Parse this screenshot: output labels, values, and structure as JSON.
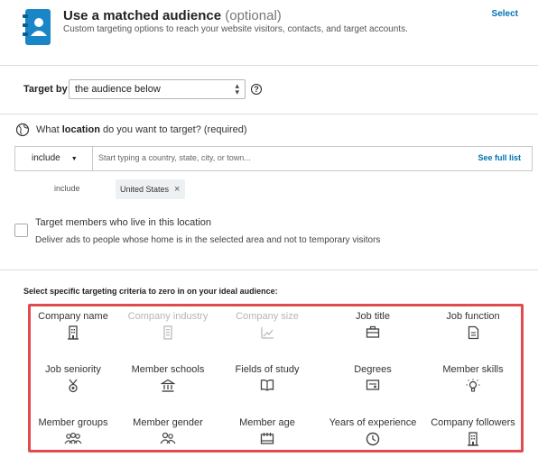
{
  "header": {
    "title_bold": "Use a matched audience",
    "title_optional": "(optional)",
    "subtitle": "Custom targeting options to reach your website visitors, contacts, and target accounts.",
    "select_link": "Select"
  },
  "target_by": {
    "label": "Target by",
    "selected": "the audience below",
    "help": "?"
  },
  "location": {
    "question_pre": "What",
    "question_bold": "location",
    "question_post": "do you want to target? (required)",
    "include_select": "include",
    "input_placeholder": "Start typing a country, state, city, or town...",
    "see_full_list": "See full list",
    "include_label": "include",
    "selected_locations": [
      "United States"
    ]
  },
  "live_in": {
    "title": "Target members who live in this location",
    "description": "Deliver ads to people whose home is in the selected area and not to temporary visitors",
    "checked": false
  },
  "criteria": {
    "label": "Select specific targeting criteria to zero in on your ideal audience:",
    "items": [
      {
        "label": "Company name",
        "icon": "building-icon",
        "enabled": true
      },
      {
        "label": "Company industry",
        "icon": "industry-icon",
        "enabled": false
      },
      {
        "label": "Company size",
        "icon": "growth-chart-icon",
        "enabled": false
      },
      {
        "label": "Job title",
        "icon": "briefcase-icon",
        "enabled": true
      },
      {
        "label": "Job function",
        "icon": "document-icon",
        "enabled": true
      },
      {
        "label": "Job seniority",
        "icon": "medal-icon",
        "enabled": true
      },
      {
        "label": "Member schools",
        "icon": "institution-icon",
        "enabled": true
      },
      {
        "label": "Fields of study",
        "icon": "book-icon",
        "enabled": true
      },
      {
        "label": "Degrees",
        "icon": "diploma-icon",
        "enabled": true
      },
      {
        "label": "Member skills",
        "icon": "lightbulb-icon",
        "enabled": true
      },
      {
        "label": "Member groups",
        "icon": "group-icon",
        "enabled": true
      },
      {
        "label": "Member gender",
        "icon": "people-icon",
        "enabled": true
      },
      {
        "label": "Member age",
        "icon": "calendar-icon",
        "enabled": true
      },
      {
        "label": "Years of experience",
        "icon": "clock-icon",
        "enabled": true
      },
      {
        "label": "Company followers",
        "icon": "building-icon",
        "enabled": true
      }
    ]
  },
  "colors": {
    "link": "#0073b1",
    "highlight_border": "#e04b4f",
    "disabled_text": "#b5b5b5"
  }
}
